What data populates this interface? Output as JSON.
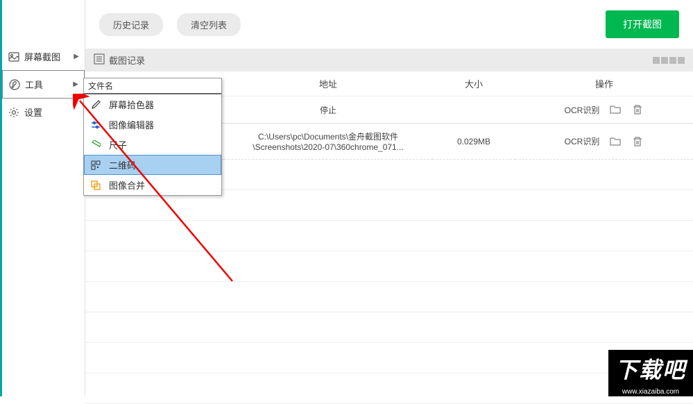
{
  "sidebar": {
    "items": [
      {
        "label": "屏幕截图",
        "has_arrow": true
      },
      {
        "label": "工具",
        "has_arrow": true
      },
      {
        "label": "设置",
        "has_arrow": false
      }
    ]
  },
  "toolbar": {
    "history_label": "历史记录",
    "clear_label": "清空列表",
    "open_capture_label": "打开截图"
  },
  "section": {
    "title": "截图记录"
  },
  "table": {
    "headers": {
      "filename": "文件名",
      "path": "地址",
      "size": "大小",
      "actions": "操作"
    },
    "rows": [
      {
        "path": "停止",
        "size": "",
        "ocr": "OCR识别"
      },
      {
        "path": "C:\\Users\\pc\\Documents\\金舟截图软件\\Screenshots\\2020-07\\360chrome_071...",
        "size": "0.029MB",
        "ocr": "OCR识别"
      }
    ]
  },
  "submenu": {
    "title": "文件名",
    "items": [
      {
        "label": "屏幕拾色器"
      },
      {
        "label": "图像编辑器"
      },
      {
        "label": "尺子"
      },
      {
        "label": "二维码"
      },
      {
        "label": "图像合并"
      }
    ]
  },
  "watermark": {
    "main": "下载吧",
    "sub": "www.xiazaiba.com"
  }
}
